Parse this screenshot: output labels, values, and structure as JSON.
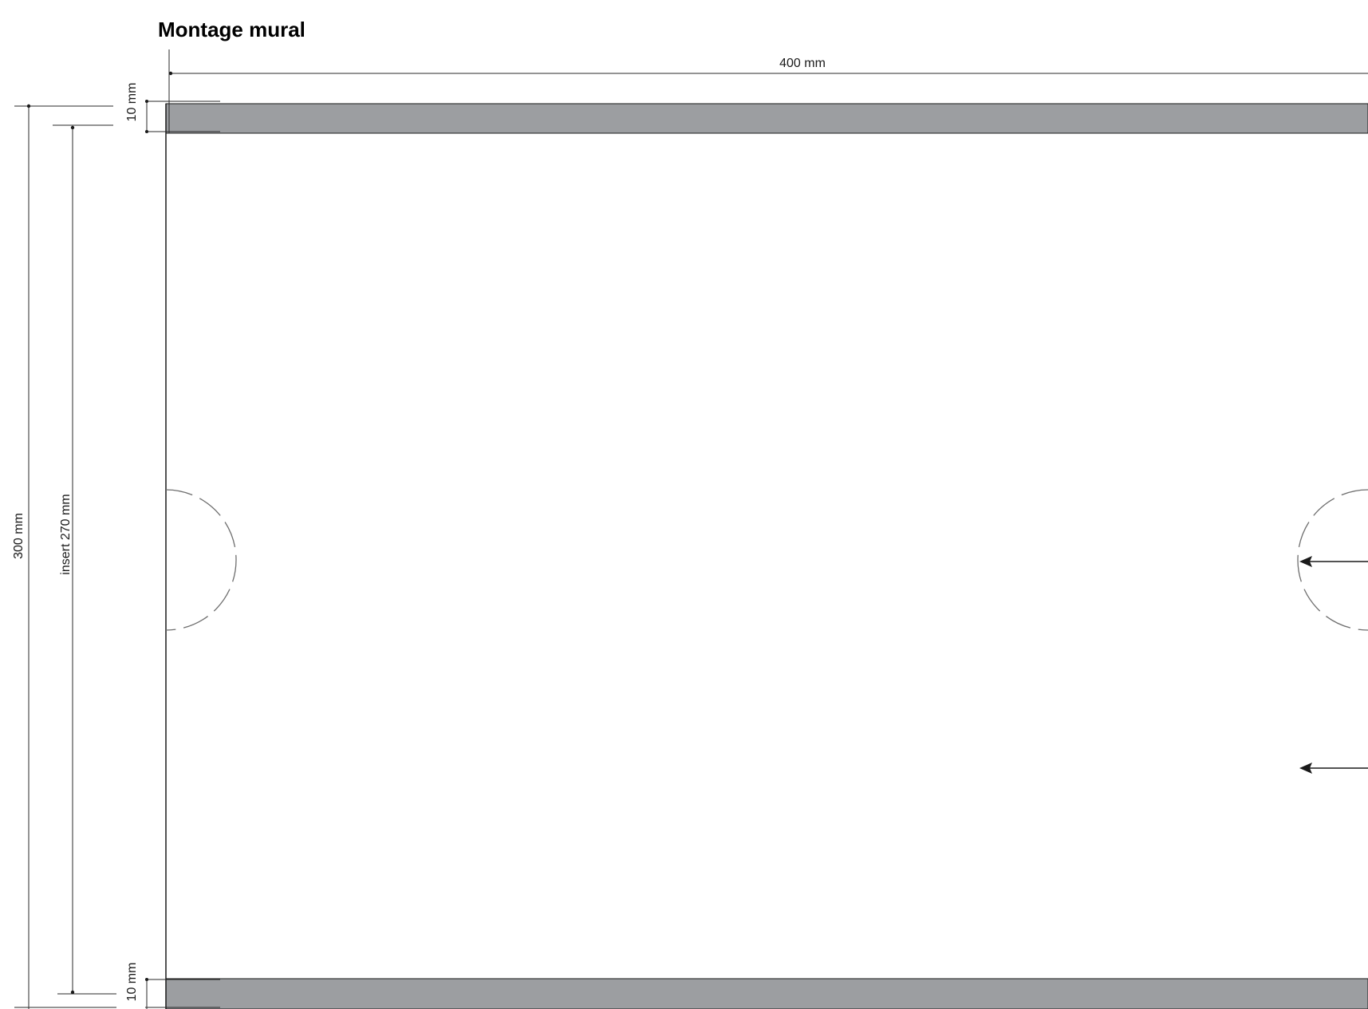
{
  "title": "Montage mural",
  "dimensions": {
    "width": "400 mm",
    "total_height": "300 mm",
    "insert_height": "insert  270 mm",
    "top_strip": "10 mm",
    "bottom_strip": "10 mm"
  },
  "colors": {
    "strip_fill": "#9c9ea1",
    "line": "#1a1a1a",
    "dashed_circle": "#6e6e6e",
    "background": "#ffffff"
  }
}
